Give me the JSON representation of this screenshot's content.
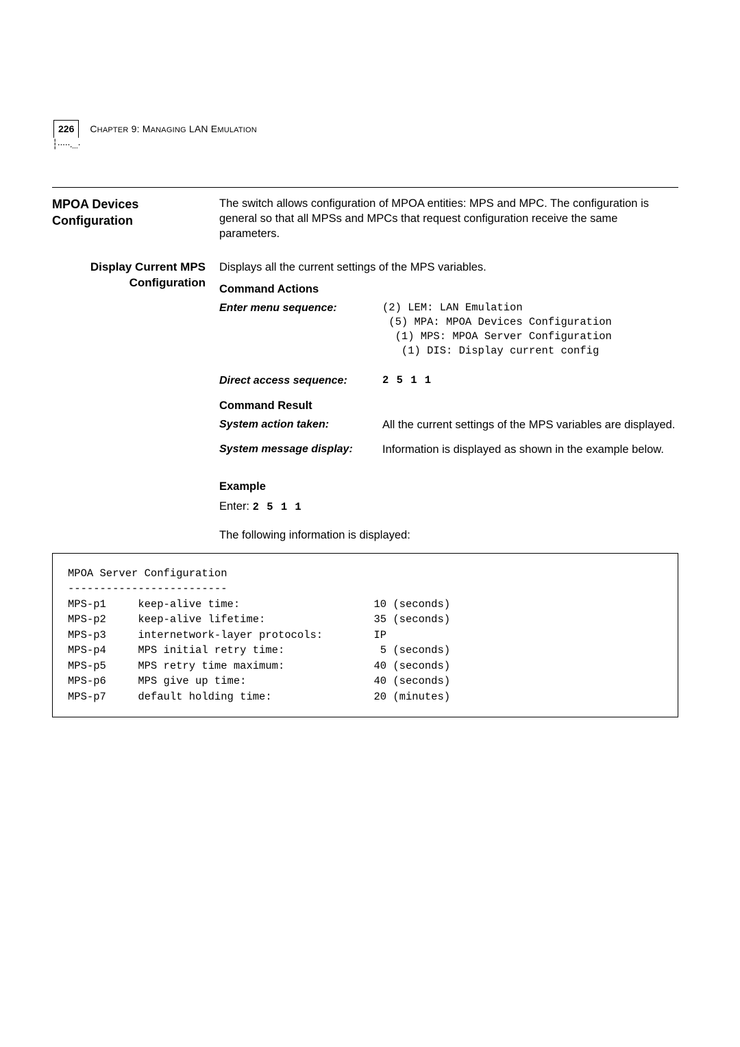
{
  "header": {
    "page_number": "226",
    "chapter_prefix": "C",
    "chapter_word_rest": "HAPTER",
    "chapter_num": " 9: M",
    "chapter_word_rest2": "ANAGING",
    "chapter_mid": " LAN E",
    "chapter_word_rest3": "MULATION"
  },
  "section": {
    "title_line1": "MPOA Devices",
    "title_line2": "Configuration",
    "intro": "The switch allows configuration of MPOA entities: MPS and MPC. The configuration is general so that all MPSs and MPCs that request configuration receive the same parameters."
  },
  "subsection": {
    "title_line1": "Display Current MPS",
    "title_line2": "Configuration",
    "intro": "Displays all the current settings of the MPS variables.",
    "command_actions_heading": "Command Actions",
    "enter_menu_label": "Enter menu sequence:",
    "enter_menu_lines": "(2) LEM: LAN Emulation\n (5) MPA: MPOA Devices Configuration\n  (1) MPS: MPOA Server Configuration\n   (1) DIS: Display current config",
    "direct_access_label": "Direct access sequence:",
    "direct_access_value": "2 5 1 1",
    "command_result_heading": "Command Result",
    "system_action_label": "System action taken:",
    "system_action_value": "All the current settings of the MPS variables are displayed.",
    "system_message_label": "System message display:",
    "system_message_value": "Information is displayed as shown in the example below.",
    "example_heading": "Example",
    "example_enter_prefix": "Enter: ",
    "example_enter_value": "2 5 1 1",
    "example_following": "The following information is displayed:"
  },
  "example_box": "MPOA Server Configuration\n-------------------------\nMPS-p1     keep-alive time:                     10 (seconds)\nMPS-p2     keep-alive lifetime:                 35 (seconds)\nMPS-p3     internetwork-layer protocols:        IP\nMPS-p4     MPS initial retry time:               5 (seconds)\nMPS-p5     MPS retry time maximum:              40 (seconds)\nMPS-p6     MPS give up time:                    40 (seconds)\nMPS-p7     default holding time:                20 (minutes)"
}
